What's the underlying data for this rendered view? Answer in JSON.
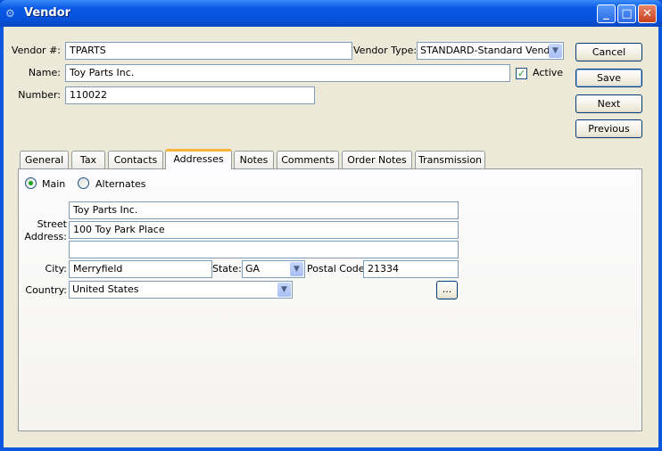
{
  "window": {
    "title": "Vendor",
    "icon": "gears-icon"
  },
  "header": {
    "vendor_no_label": "Vendor #:",
    "vendor_no": "TPARTS",
    "vendor_type_label": "Vendor Type:",
    "vendor_type": "STANDARD-Standard Vendor",
    "name_label": "Name:",
    "name": "Toy Parts Inc.",
    "active_label": "Active",
    "active": true,
    "number_label": "Number:",
    "number": "110022"
  },
  "buttons": {
    "cancel": "Cancel",
    "save": "Save",
    "next": "Next",
    "previous": "Previous"
  },
  "tabs": [
    "General",
    "Tax",
    "Contacts",
    "Addresses",
    "Notes",
    "Comments",
    "Order Notes",
    "Transmission"
  ],
  "selected_tab": "Addresses",
  "addresses": {
    "main_label": "Main",
    "alternates_label": "Alternates",
    "selected": "Main",
    "street_label_1": "Street",
    "street_label_2": "Address:",
    "street1": "Toy Parts Inc.",
    "street2": "100 Toy Park Place",
    "street3": "",
    "city_label": "City:",
    "city": "Merryfield",
    "state_label": "State:",
    "state": "GA",
    "postal_label": "Postal Code:",
    "postal": "21334",
    "country_label": "Country:",
    "country": "United States",
    "more_button": "..."
  }
}
